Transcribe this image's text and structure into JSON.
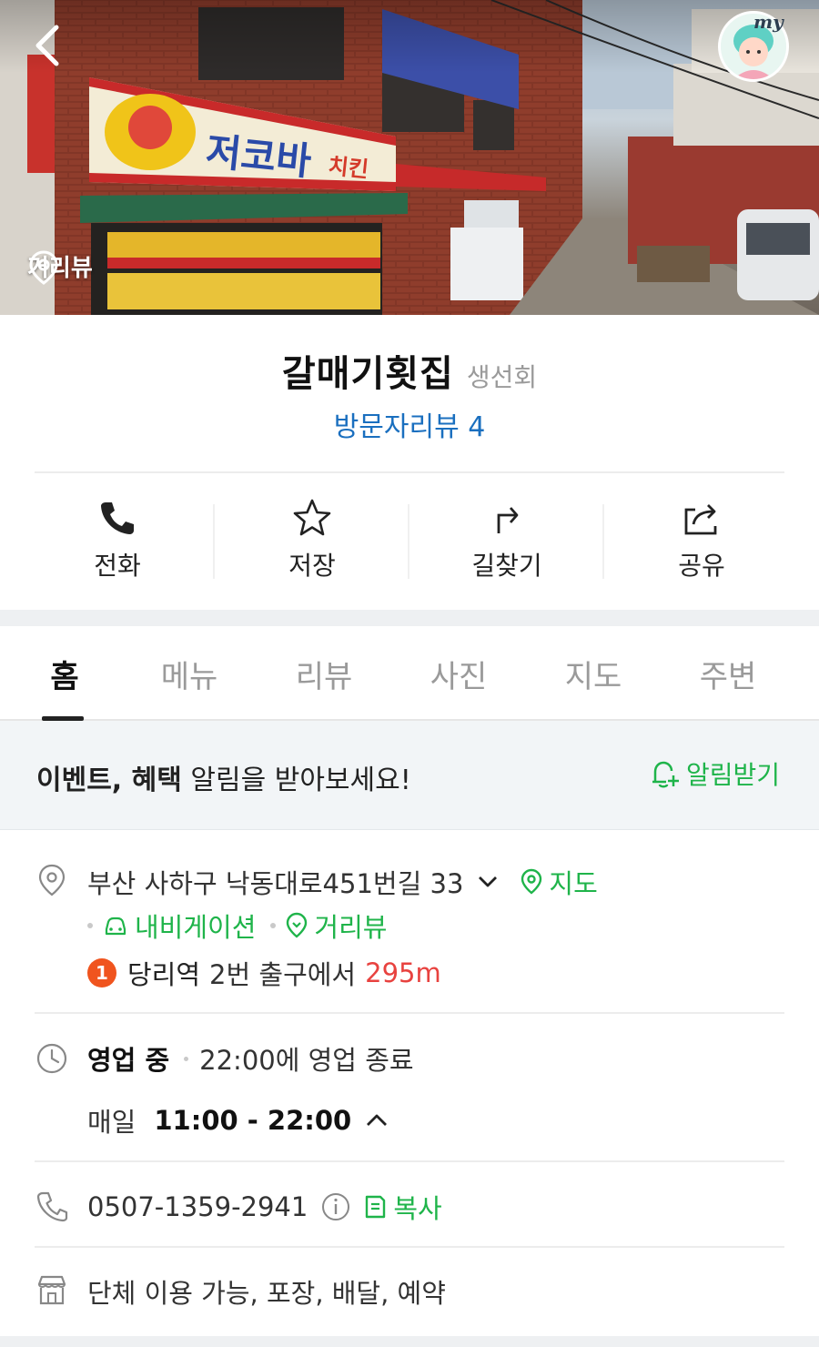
{
  "hero": {
    "streetview_label": "거리뷰",
    "my_label": "my"
  },
  "place": {
    "name": "갈매기횟집",
    "category": "생선회",
    "review_link": "방문자리뷰 4"
  },
  "actions": [
    {
      "label": "전화",
      "icon": "phone-icon"
    },
    {
      "label": "저장",
      "icon": "star-icon"
    },
    {
      "label": "길찾기",
      "icon": "directions-icon"
    },
    {
      "label": "공유",
      "icon": "share-icon"
    }
  ],
  "tabs": [
    {
      "label": "홈",
      "active": true
    },
    {
      "label": "메뉴",
      "active": false
    },
    {
      "label": "리뷰",
      "active": false
    },
    {
      "label": "사진",
      "active": false
    },
    {
      "label": "지도",
      "active": false
    },
    {
      "label": "주변",
      "active": false
    }
  ],
  "notice": {
    "bold_text": "이벤트, 혜택",
    "text": " 알림을 받아보세요!",
    "action_label": "알림받기"
  },
  "address": {
    "text": "부산 사하구 낙동대로451번길 33",
    "map_label": "지도",
    "navigation_label": "내비게이션",
    "streetview_label": "거리뷰"
  },
  "subway": {
    "line_number": "1",
    "station": "당리역",
    "exit_text": "2번 출구에서",
    "distance": "295m"
  },
  "hours": {
    "status": "영업 중",
    "close_text": "22:00에 영업 종료",
    "days": "매일",
    "time_range": "11:00 - 22:00"
  },
  "phone": {
    "number": "0507-1359-2941",
    "copy_label": "복사"
  },
  "facilities": {
    "text": "단체 이용 가능, 포장, 배달, 예약"
  },
  "colors": {
    "accent_green": "#1fb44a",
    "link_blue": "#1a6fbf",
    "distance_red": "#e8423f",
    "line1_orange": "#f0541e"
  }
}
